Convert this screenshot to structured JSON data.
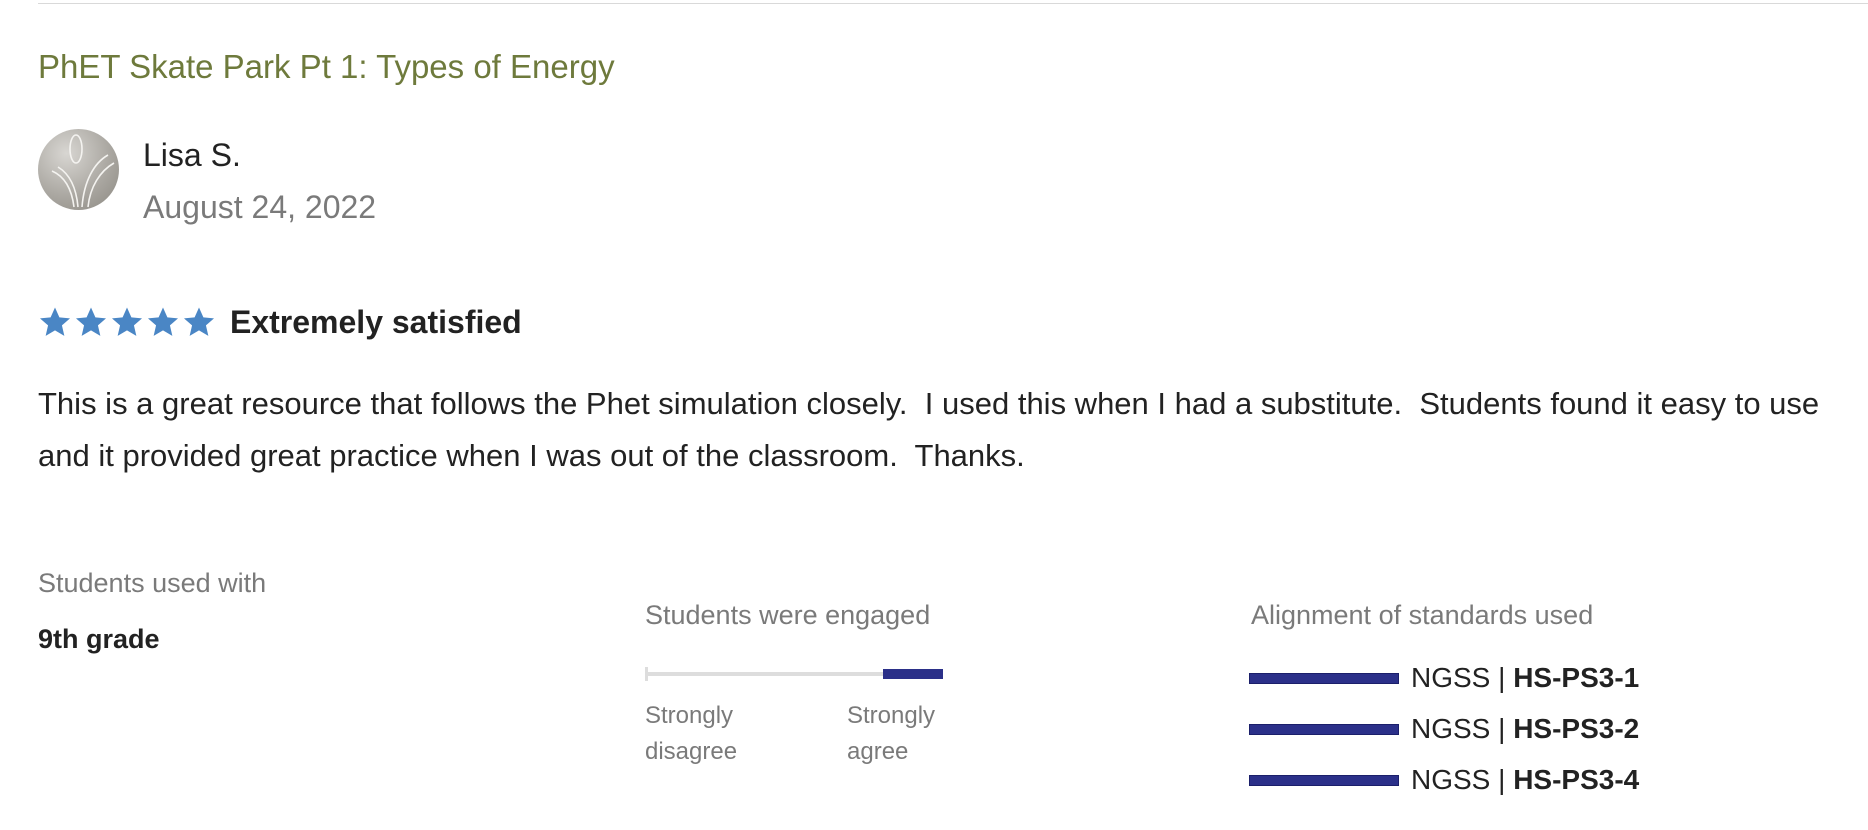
{
  "review": {
    "resource_title": "PhET Skate Park Pt 1: Types of Energy",
    "reviewer_name": "Lisa S.",
    "date": "August 24, 2022",
    "rating": {
      "stars": 5,
      "max_stars": 5,
      "label": "Extremely satisfied",
      "star_color": "#4a86c5"
    },
    "body": "This is a great resource that follows the Phet simulation closely.  I used this when I had a substitute.  Students found it easy to use and it provided great practice when I was out of the classroom.  Thanks."
  },
  "details": {
    "students_used_with": {
      "label": "Students used with",
      "value": "9th grade"
    },
    "engagement": {
      "label": "Students were engaged",
      "scale_min_label": "Strongly disagree",
      "scale_max_label": "Strongly agree",
      "level": 0.2,
      "fill_color": "#2b3089"
    },
    "standards": {
      "label": "Alignment of standards used",
      "items": [
        {
          "framework": "NGSS",
          "separator": " | ",
          "code": "HS-PS3-1"
        },
        {
          "framework": "NGSS",
          "separator": " | ",
          "code": "HS-PS3-2"
        },
        {
          "framework": "NGSS",
          "separator": " | ",
          "code": "HS-PS3-4"
        }
      ]
    }
  }
}
